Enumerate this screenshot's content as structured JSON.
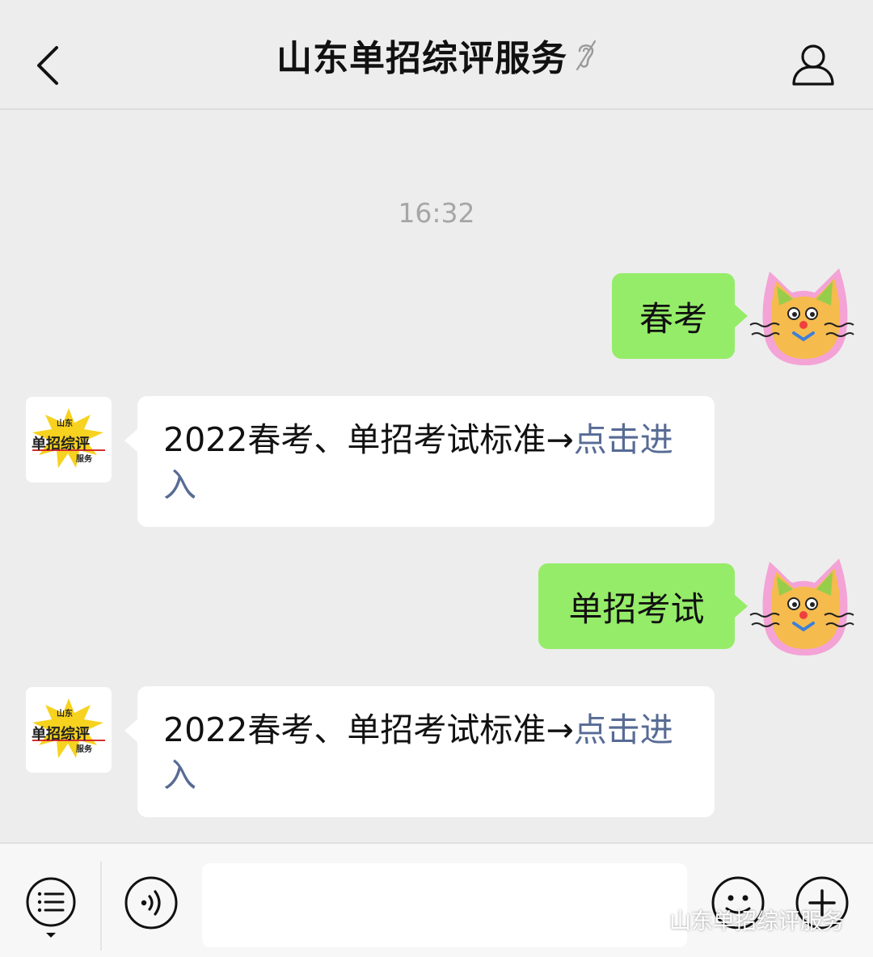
{
  "header": {
    "title": "山东单招综评服务",
    "back_icon": "chevron-left-icon",
    "mute_icon": "ear-icon",
    "profile_icon": "person-icon"
  },
  "chat": {
    "timestamp": "16:32",
    "messages": [
      {
        "direction": "outgoing",
        "text": "春考"
      },
      {
        "direction": "incoming",
        "text": "2022春考、单招考试标准→",
        "link": "点击进入"
      },
      {
        "direction": "outgoing",
        "text": "单招考试"
      },
      {
        "direction": "incoming",
        "text": "2022春考、单招考试标准→",
        "link": "点击进入"
      }
    ],
    "user_avatar": "cat-sticker-avatar",
    "bot_avatar": {
      "icon": "account-logo-avatar",
      "words": [
        "山东",
        "单招综评",
        "服务"
      ]
    }
  },
  "input_bar": {
    "menu_icon": "menu-list-icon",
    "voice_icon": "voice-icon",
    "emoji_icon": "emoji-icon",
    "plus_icon": "plus-icon",
    "input_value": ""
  },
  "watermark": {
    "icon": "wechat-icon",
    "text": "山东单招综评服务"
  },
  "colors": {
    "background": "#ededed",
    "outgoing_bubble": "#95ec69",
    "incoming_bubble": "#ffffff",
    "link": "#576b95",
    "timestamp": "#a6a6a6"
  }
}
